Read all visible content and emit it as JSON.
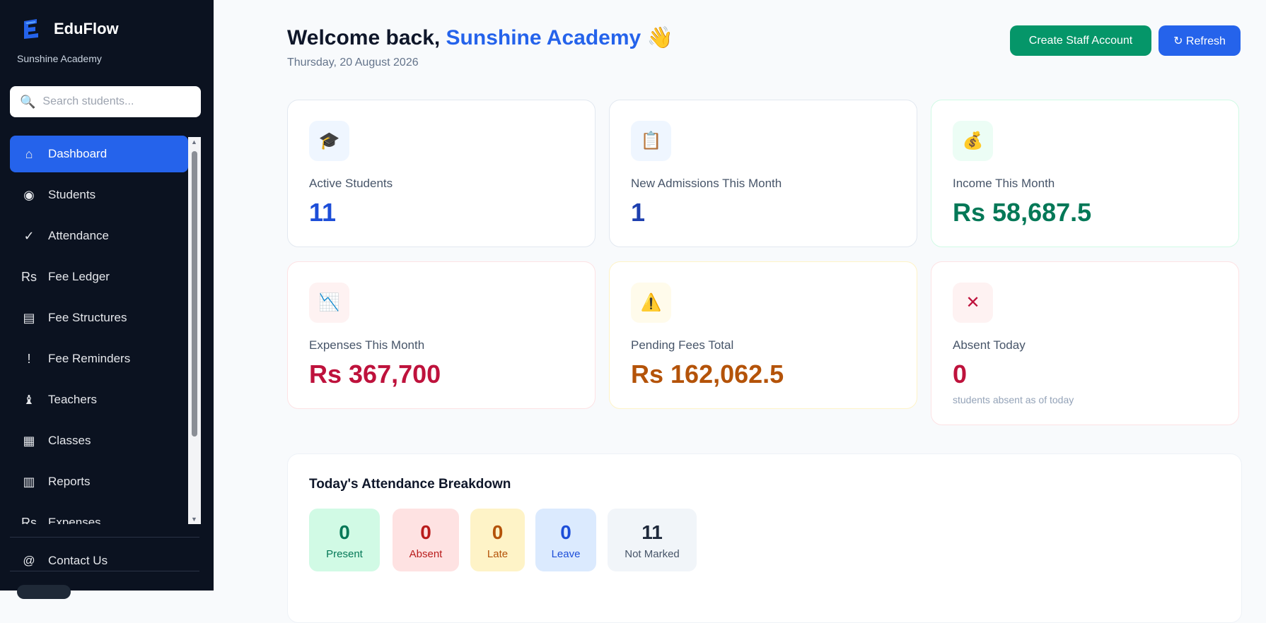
{
  "brand": {
    "name": "EduFlow",
    "subtitle": "Sunshine Academy"
  },
  "search": {
    "placeholder": "Search students..."
  },
  "nav": {
    "items": [
      {
        "label": "Dashboard",
        "icon": "home-icon",
        "glyph": "⌂",
        "active": true
      },
      {
        "label": "Students",
        "icon": "students-icon",
        "glyph": "◉"
      },
      {
        "label": "Attendance",
        "icon": "check-icon",
        "glyph": "✓"
      },
      {
        "label": "Fee Ledger",
        "icon": "rupee-icon",
        "glyph": "Rs"
      },
      {
        "label": "Fee Structures",
        "icon": "structure-icon",
        "glyph": "▤"
      },
      {
        "label": "Fee Reminders",
        "icon": "alert-icon",
        "glyph": "!"
      },
      {
        "label": "Teachers",
        "icon": "teacher-icon",
        "glyph": "♝"
      },
      {
        "label": "Classes",
        "icon": "classes-icon",
        "glyph": "▦"
      },
      {
        "label": "Reports",
        "icon": "reports-icon",
        "glyph": "▥"
      },
      {
        "label": "Expenses",
        "icon": "rupee-icon",
        "glyph": "Rs"
      }
    ],
    "contact": {
      "label": "Contact Us",
      "icon": "at-icon",
      "glyph": "@"
    }
  },
  "header": {
    "welcome_prefix": "Welcome back, ",
    "school": "Sunshine Academy",
    "wave": "👋",
    "date": "Thursday, 20 August 2026",
    "create_staff_label": "Create Staff Account",
    "refresh_label": "↻ Refresh"
  },
  "stats": [
    {
      "label": "Active Students",
      "value": "11",
      "emoji": "🎓",
      "icon": "graduation-cap-icon"
    },
    {
      "label": "New Admissions This Month",
      "value": "1",
      "emoji": "📋",
      "icon": "clipboard-icon"
    },
    {
      "label": "Income This Month",
      "value": "Rs 58,687.5",
      "emoji": "💰",
      "icon": "money-bag-icon"
    },
    {
      "label": "Expenses This Month",
      "value": "Rs 367,700",
      "emoji": "📉",
      "icon": "chart-down-icon"
    },
    {
      "label": "Pending Fees Total",
      "value": "Rs 162,062.5",
      "emoji": "⚠️",
      "icon": "warning-icon"
    },
    {
      "label": "Absent Today",
      "value": "0",
      "emoji": "✕",
      "icon": "close-icon",
      "sub": "students absent as of today"
    }
  ],
  "attendance": {
    "title": "Today's Attendance Breakdown",
    "items": [
      {
        "label": "Present",
        "count": "0"
      },
      {
        "label": "Absent",
        "count": "0"
      },
      {
        "label": "Late",
        "count": "0"
      },
      {
        "label": "Leave",
        "count": "0"
      },
      {
        "label": "Not Marked",
        "count": "11"
      }
    ]
  },
  "colors": {
    "accent": "#2563eb",
    "green": "#059669",
    "sidebar": "#0b1220",
    "income": "#047857",
    "expense": "#be123c",
    "pending": "#b45309"
  }
}
